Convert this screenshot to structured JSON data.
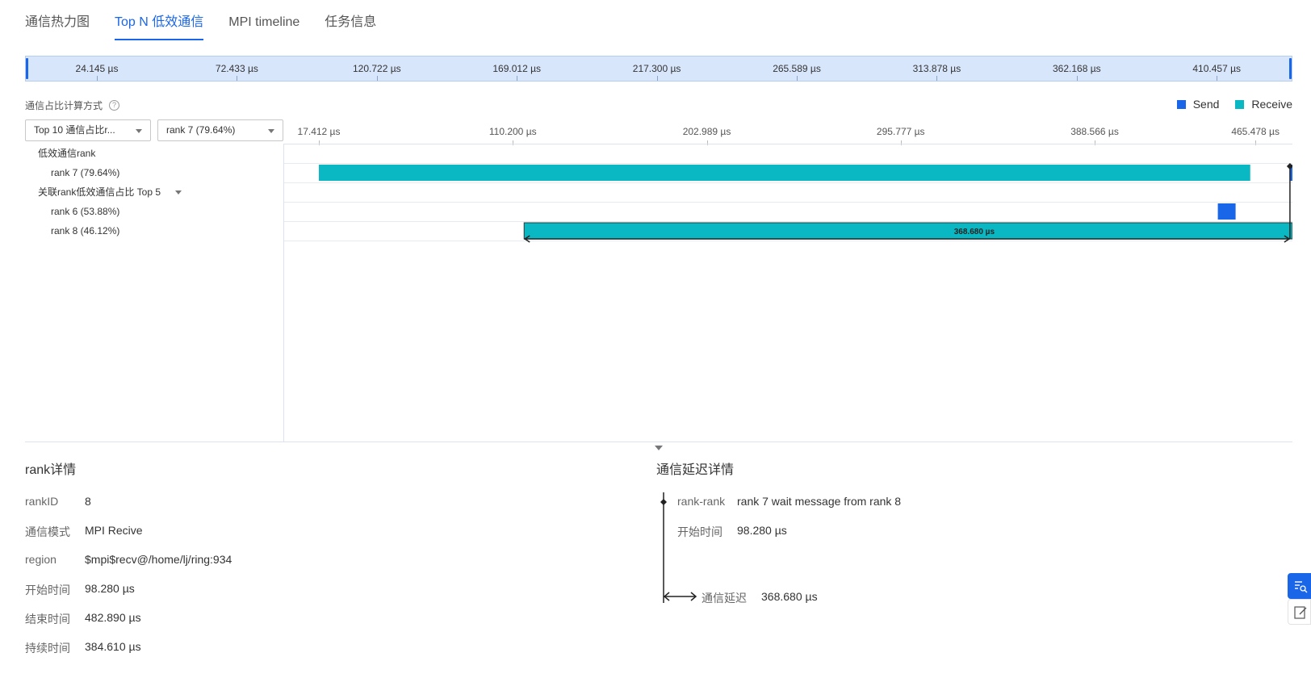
{
  "tabs": [
    {
      "label": "通信热力图",
      "active": false
    },
    {
      "label": "Top N 低效通信",
      "active": true
    },
    {
      "label": "MPI timeline",
      "active": false
    },
    {
      "label": "任务信息",
      "active": false
    }
  ],
  "overview": {
    "ticks": [
      "24.145 µs",
      "72.433 µs",
      "120.722 µs",
      "169.012 µs",
      "217.300 µs",
      "265.589 µs",
      "313.878 µs",
      "362.168 µs",
      "410.457 µs"
    ]
  },
  "calc": {
    "label": "通信占比计算方式",
    "help_icon": "question-circle-icon",
    "select1": "Top 10 通信占比r...",
    "select2": "rank 7 (79.64%)"
  },
  "legend": [
    {
      "label": "Send",
      "color": "#1a66e8"
    },
    {
      "label": "Receive",
      "color": "#0ab8c3"
    }
  ],
  "tree": {
    "group1": "低效通信rank",
    "rank7": "rank 7 (79.64%)",
    "group2": "关联rank低效通信占比 Top 5",
    "rank6": "rank 6 (53.88%)",
    "rank8": "rank 8 (46.12%)"
  },
  "chart_data": {
    "type": "gantt",
    "axis_ticks": [
      "17.412 µs",
      "110.200 µs",
      "202.989 µs",
      "295.777 µs",
      "388.566 µs",
      "465.478 µs"
    ],
    "axis_tick_values": [
      17.412,
      110.2,
      202.989,
      295.777,
      388.566,
      465.478
    ],
    "bars": [
      {
        "lane": "rank 7",
        "kind": "Receive",
        "start": 17.412,
        "end": 463.0
      },
      {
        "lane": "rank 7",
        "kind": "Send",
        "start": 482.0,
        "end": 491.0
      },
      {
        "lane": "rank 6",
        "kind": "Send",
        "start": 447.5,
        "end": 456.0
      },
      {
        "lane": "rank 8",
        "kind": "Receive",
        "start": 115.6,
        "end": 500.0
      }
    ],
    "delay_label": "368.680 µs"
  },
  "rank_detail": {
    "title": "rank详情",
    "rows": [
      {
        "k": "rankID",
        "v": "8"
      },
      {
        "k": "通信模式",
        "v": "MPI Recive"
      },
      {
        "k": "region",
        "v": "$mpi$recv@/home/lj/ring:934"
      },
      {
        "k": "开始时间",
        "v": "98.280 µs"
      },
      {
        "k": "结束时间",
        "v": "482.890 µs"
      },
      {
        "k": "持续时间",
        "v": "384.610 µs"
      }
    ]
  },
  "delay_detail": {
    "title": "通信延迟详情",
    "rank_rank_k": "rank-rank",
    "rank_rank_v": "rank 7 wait message from rank 8",
    "start_k": "开始时间",
    "start_v": "98.280 µs",
    "delay_k": "通信延迟",
    "delay_v": "368.680 µs"
  },
  "colors": {
    "accent": "#1a66e8",
    "receive": "#0ab8c3",
    "send": "#1a66e8"
  },
  "side_buttons": [
    "search-report-icon",
    "edit-note-icon"
  ]
}
